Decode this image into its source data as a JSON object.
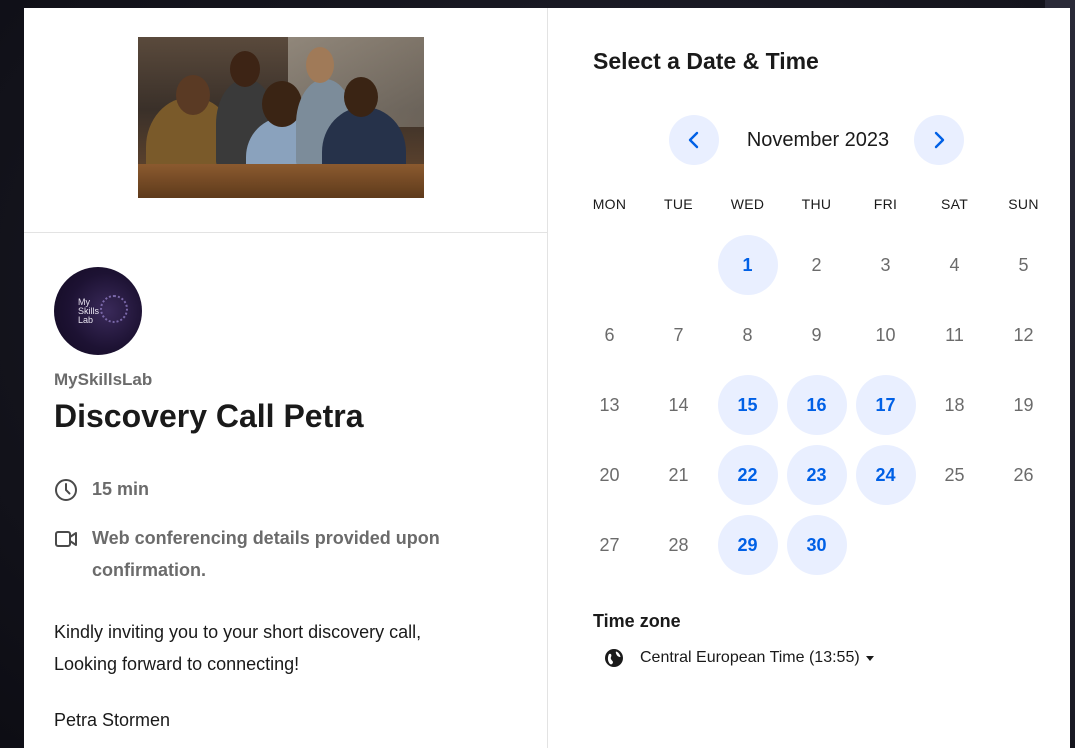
{
  "event": {
    "org_name": "MySkillsLab",
    "logo_text": "My\nSkills\nLab",
    "title": "Discovery Call Petra",
    "duration": "15 min",
    "conferencing": "Web conferencing details provided upon confirmation.",
    "description_line1": "Kindly inviting you to your short discovery call,",
    "description_line2": "Looking forward to connecting!",
    "signer": "Petra Stormen"
  },
  "calendar": {
    "title": "Select a Date & Time",
    "month": "November 2023",
    "prev_icon": "chevron-left-icon",
    "next_icon": "chevron-right-icon",
    "weekdays": [
      "MON",
      "TUE",
      "WED",
      "THU",
      "FRI",
      "SAT",
      "SUN"
    ],
    "first_weekday_index": 2,
    "days_in_month": 30,
    "available_days": [
      1,
      15,
      16,
      17,
      22,
      23,
      24,
      29,
      30
    ]
  },
  "timezone": {
    "label": "Time zone",
    "value": "Central European Time (13:55)",
    "icon": "globe-icon"
  },
  "colors": {
    "accent": "#0060e6",
    "available_bg": "#e9efff",
    "muted_text": "#6b6b6b"
  }
}
